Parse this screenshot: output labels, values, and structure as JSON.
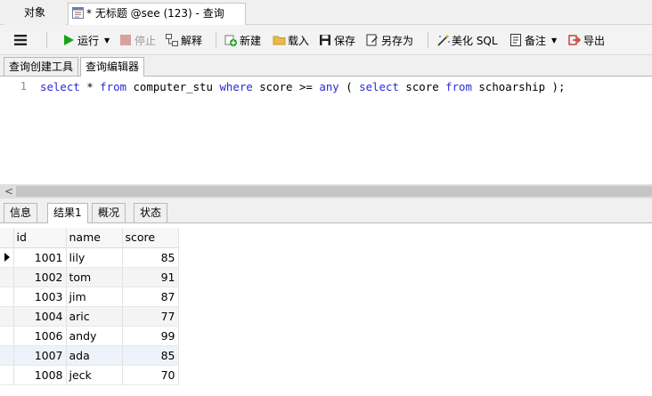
{
  "window_tabs": {
    "objects": "对象",
    "query": "* 无标题 @see (123) - 查询"
  },
  "toolbar": {
    "run": "运行",
    "stop": "停止",
    "explain": "解释",
    "new": "新建",
    "load": "载入",
    "save": "保存",
    "save_as": "另存为",
    "beautify": "美化 SQL",
    "note": "备注",
    "export": "导出"
  },
  "editor_tabs": {
    "builder": "查询创建工具",
    "editor": "查询编辑器"
  },
  "editor": {
    "line_number": "1",
    "sql": {
      "t1": "select",
      "t2": " * ",
      "t3": "from",
      "t4": " computer_stu ",
      "t5": "where",
      "t6": " score >= ",
      "t7": "any",
      "t8": " ( ",
      "t9": "select",
      "t10": " score ",
      "t11": "from",
      "t12": " schoarship );"
    }
  },
  "result_tabs": {
    "info": "信息",
    "result1": "结果1",
    "profile": "概况",
    "status": "状态"
  },
  "grid": {
    "columns": [
      "id",
      "name",
      "score"
    ],
    "rows": [
      [
        "1001",
        "lily",
        "85"
      ],
      [
        "1002",
        "tom",
        "91"
      ],
      [
        "1003",
        "jim",
        "87"
      ],
      [
        "1004",
        "aric",
        "77"
      ],
      [
        "1006",
        "andy",
        "99"
      ],
      [
        "1007",
        "ada",
        "85"
      ],
      [
        "1008",
        "jeck",
        "70"
      ]
    ]
  },
  "colors": {
    "keyword": "#2a2ad6",
    "run_green": "#1aa31a",
    "stop_red": "#d9a0a0"
  }
}
